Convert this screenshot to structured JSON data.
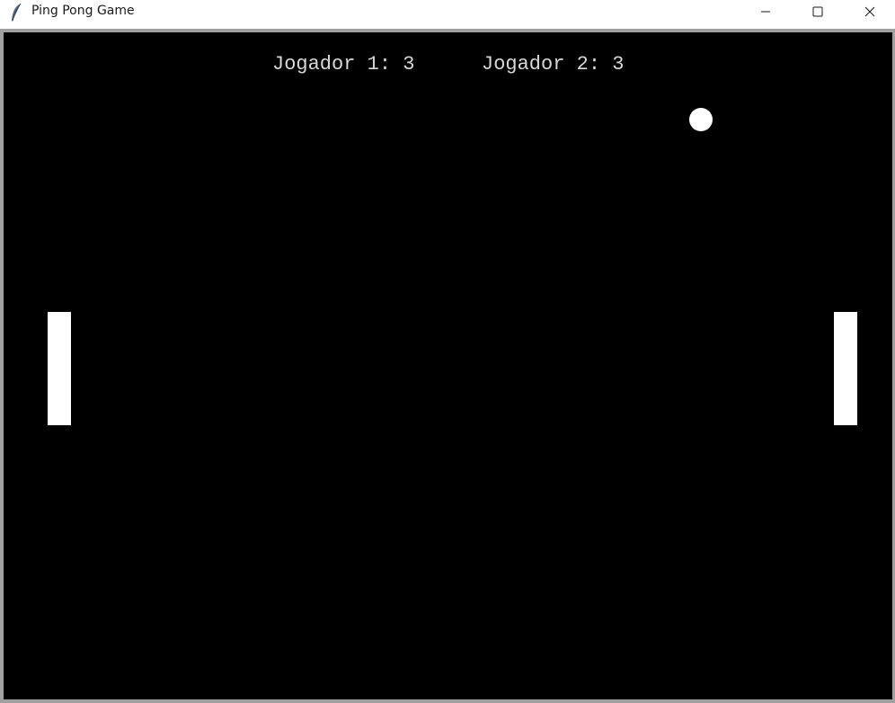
{
  "window": {
    "title": "Ping Pong Game",
    "icon": "feather-icon",
    "controls": {
      "minimize": "minimize-icon",
      "maximize": "maximize-icon",
      "close": "close-icon"
    }
  },
  "game": {
    "background_color": "#000000",
    "foreground_color": "#ffffff",
    "score_color": "#d8d8d8",
    "scores": {
      "player1_label": "Jogador 1: 3",
      "player2_label": "Jogador 2: 3"
    }
  }
}
